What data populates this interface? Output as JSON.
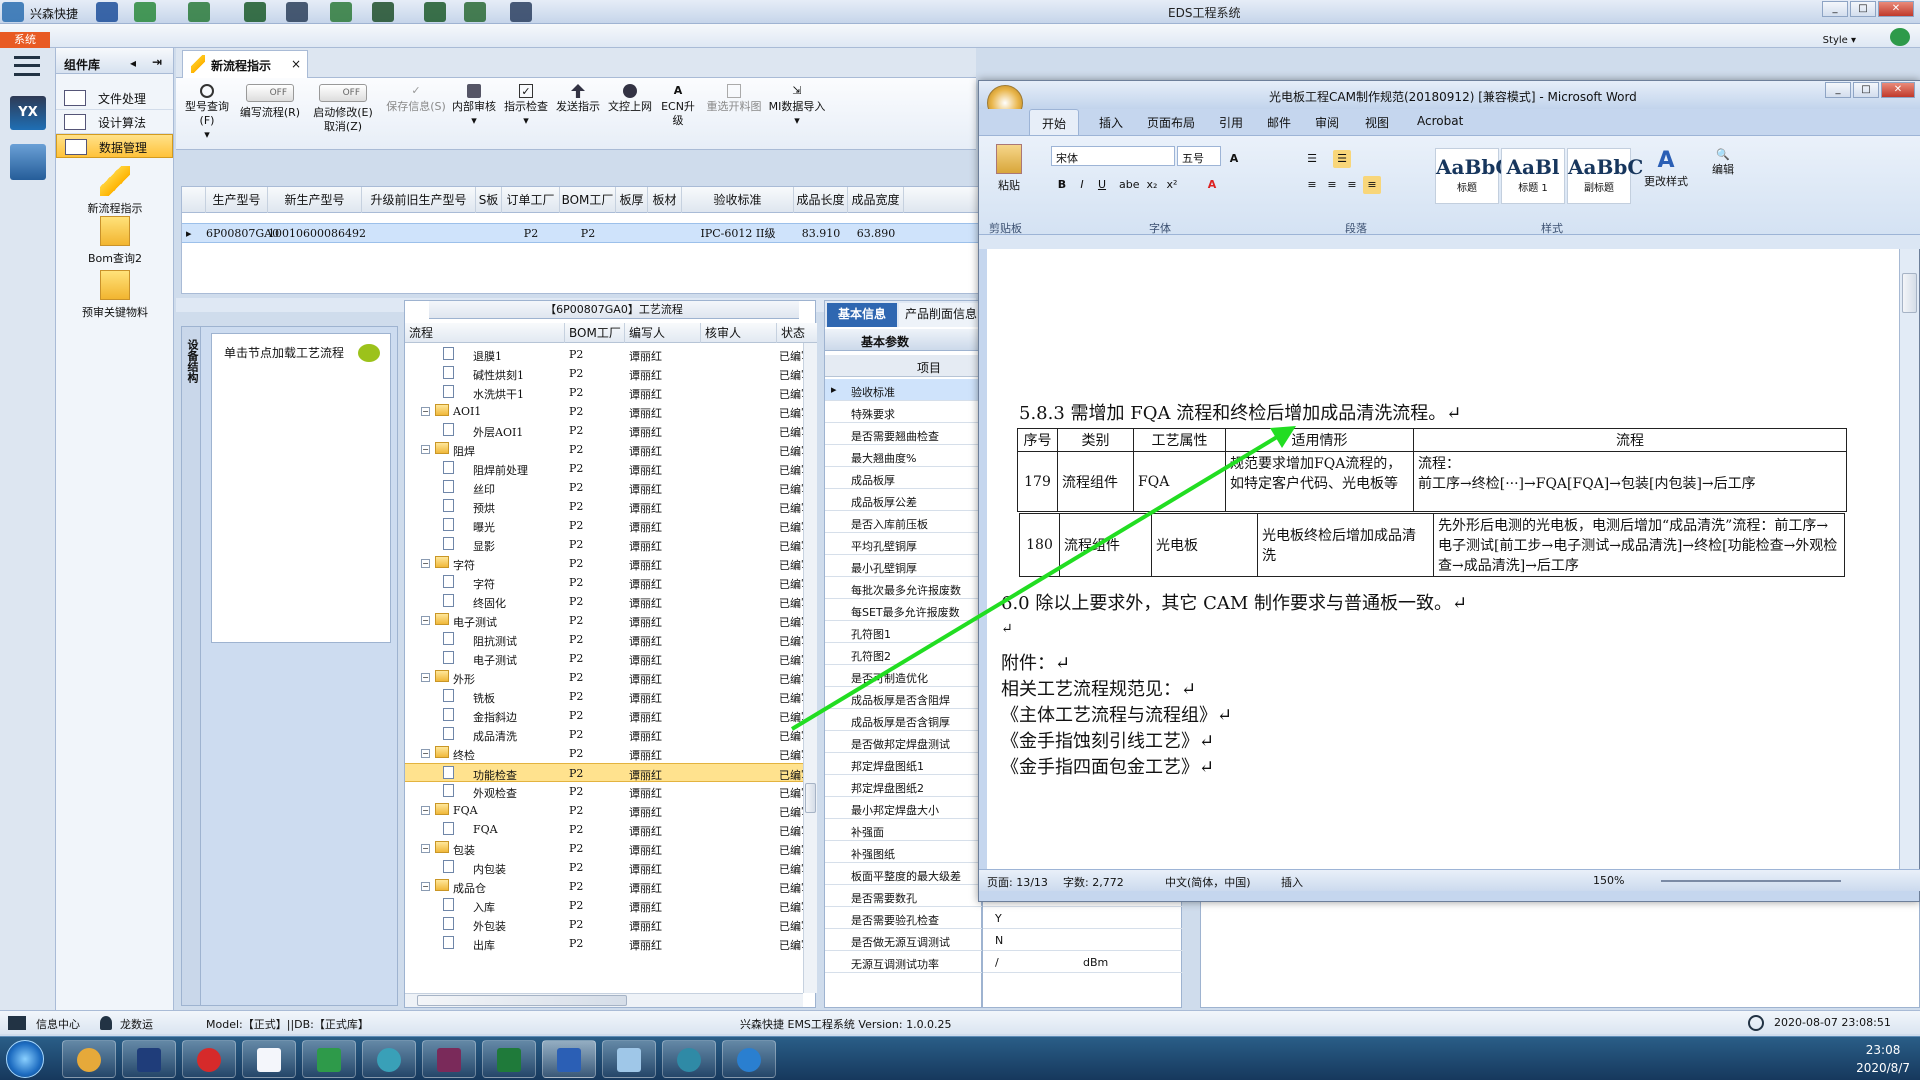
{
  "app": {
    "title": "EDS工程系统",
    "quick_label": "兴森快捷",
    "system_btn": "系统",
    "style_label": "Style"
  },
  "component_lib": {
    "header": "组件库",
    "nav": [
      {
        "label": "文件处理"
      },
      {
        "label": "设计算法"
      },
      {
        "label": "数据管理"
      }
    ],
    "tools": [
      {
        "label": "新流程指示"
      },
      {
        "label": "Bom查询2"
      },
      {
        "label": "预审关键物料"
      }
    ]
  },
  "doc_tab": "新流程指示",
  "ribbon": [
    {
      "label": "型号查询(F)"
    },
    {
      "label": "编写流程(R)",
      "toggle": "OFF"
    },
    {
      "label": "启动修改(E)",
      "label2": "取消(Z)",
      "toggle": "OFF"
    },
    {
      "label": "保存信息(S)"
    },
    {
      "label": "内部审核"
    },
    {
      "label": "指示检查"
    },
    {
      "label": "发送指示"
    },
    {
      "label": "文控上网"
    },
    {
      "label": "ECN升级"
    },
    {
      "label": "重选开料图"
    },
    {
      "label": "MI数据导入"
    }
  ],
  "grid": {
    "columns": [
      "生产型号",
      "新生产型号",
      "升级前旧生产型号",
      "S板",
      "订单工厂",
      "BOM工厂",
      "板厚",
      "板材",
      "验收标准",
      "成品长度",
      "成品宽度"
    ],
    "row": [
      "6P00807GA0",
      "10010600086492",
      "",
      "",
      "P2",
      "P2",
      "",
      "",
      "IPC-6012 II级",
      "83.910",
      "63.890"
    ]
  },
  "left_vertical": "设备结构",
  "left_hint": "单击节点加载工艺流程",
  "tree": {
    "title": "【6P00807GA0】工艺流程",
    "columns": [
      "流程",
      "BOM工厂",
      "编写人",
      "核审人",
      "状态"
    ],
    "rows": [
      {
        "name": "退膜1",
        "level": 2,
        "bom": "P2",
        "writer": "谭丽红",
        "status": "已编写"
      },
      {
        "name": "碱性烘刻1",
        "level": 2,
        "bom": "P2",
        "writer": "谭丽红",
        "status": "已编写"
      },
      {
        "name": "水洗烘干1",
        "level": 2,
        "bom": "P2",
        "writer": "谭丽红",
        "status": "已编写"
      },
      {
        "name": "AOI1",
        "level": 1,
        "bom": "P2",
        "writer": "谭丽红",
        "status": "已编写"
      },
      {
        "name": "外层AOI1",
        "level": 2,
        "bom": "P2",
        "writer": "谭丽红",
        "status": "已编写"
      },
      {
        "name": "阻焊",
        "level": 1,
        "bom": "P2",
        "writer": "谭丽红",
        "status": "已编写"
      },
      {
        "name": "阻焊前处理",
        "level": 2,
        "bom": "P2",
        "writer": "谭丽红",
        "status": "已编写"
      },
      {
        "name": "丝印",
        "level": 2,
        "bom": "P2",
        "writer": "谭丽红",
        "status": "已编写"
      },
      {
        "name": "预烘",
        "level": 2,
        "bom": "P2",
        "writer": "谭丽红",
        "status": "已编写"
      },
      {
        "name": "曝光",
        "level": 2,
        "bom": "P2",
        "writer": "谭丽红",
        "status": "已编写"
      },
      {
        "name": "显影",
        "level": 2,
        "bom": "P2",
        "writer": "谭丽红",
        "status": "已编写"
      },
      {
        "name": "字符",
        "level": 1,
        "bom": "P2",
        "writer": "谭丽红",
        "status": "已编写"
      },
      {
        "name": "字符",
        "level": 2,
        "bom": "P2",
        "writer": "谭丽红",
        "status": "已编写"
      },
      {
        "name": "终固化",
        "level": 2,
        "bom": "P2",
        "writer": "谭丽红",
        "status": "已编写"
      },
      {
        "name": "电子测试",
        "level": 1,
        "bom": "P2",
        "writer": "谭丽红",
        "status": "已编写"
      },
      {
        "name": "阻抗测试",
        "level": 2,
        "bom": "P2",
        "writer": "谭丽红",
        "status": "已编写"
      },
      {
        "name": "电子测试",
        "level": 2,
        "bom": "P2",
        "writer": "谭丽红",
        "status": "已编写"
      },
      {
        "name": "外形",
        "level": 1,
        "bom": "P2",
        "writer": "谭丽红",
        "status": "已编写"
      },
      {
        "name": "铣板",
        "level": 2,
        "bom": "P2",
        "writer": "谭丽红",
        "status": "已编写"
      },
      {
        "name": "金指斜边",
        "level": 2,
        "bom": "P2",
        "writer": "谭丽红",
        "status": "已编写"
      },
      {
        "name": "成品清洗",
        "level": 2,
        "bom": "P2",
        "writer": "谭丽红",
        "status": "已编写"
      },
      {
        "name": "终检",
        "level": 1,
        "bom": "P2",
        "writer": "谭丽红",
        "status": "已编写"
      },
      {
        "name": "功能检查",
        "level": 2,
        "bom": "P2",
        "writer": "谭丽红",
        "status": "已编写",
        "selected": true
      },
      {
        "name": "外观检查",
        "level": 2,
        "bom": "P2",
        "writer": "谭丽红",
        "status": "已编写"
      },
      {
        "name": "FQA",
        "level": 1,
        "bom": "P2",
        "writer": "谭丽红",
        "status": "已编写"
      },
      {
        "name": "FQA",
        "level": 2,
        "bom": "P2",
        "writer": "谭丽红",
        "status": "已编写"
      },
      {
        "name": "包装",
        "level": 1,
        "bom": "P2",
        "writer": "谭丽红",
        "status": "已编写"
      },
      {
        "name": "内包装",
        "level": 2,
        "bom": "P2",
        "writer": "谭丽红",
        "status": "已编写"
      },
      {
        "name": "成品仓",
        "level": 1,
        "bom": "P2",
        "writer": "谭丽红",
        "status": "已编写"
      },
      {
        "name": "入库",
        "level": 2,
        "bom": "P2",
        "writer": "谭丽红",
        "status": "已编写"
      },
      {
        "name": "外包装",
        "level": 2,
        "bom": "P2",
        "writer": "谭丽红",
        "status": "已编写"
      },
      {
        "name": "出库",
        "level": 2,
        "bom": "P2",
        "writer": "谭丽红",
        "status": "已编写"
      }
    ]
  },
  "props": {
    "tab1": "基本信息",
    "tab2": "产品削面信息",
    "section": "基本参数",
    "col": "项目",
    "rows": [
      {
        "label": "验收标准",
        "selected": true
      },
      {
        "label": "特殊要求"
      },
      {
        "label": "是否需要翘曲检查"
      },
      {
        "label": "最大翘曲度%"
      },
      {
        "label": "成品板厚"
      },
      {
        "label": "成品板厚公差"
      },
      {
        "label": "是否入库前压板"
      },
      {
        "label": "平均孔壁铜厚"
      },
      {
        "label": "最小孔壁铜厚"
      },
      {
        "label": "每批次最多允许报废数"
      },
      {
        "label": "每SET最多允许报废数"
      },
      {
        "label": "孔符图1"
      },
      {
        "label": "孔符图2"
      },
      {
        "label": "是否可制造优化"
      },
      {
        "label": "成品板厚是否含阻焊"
      },
      {
        "label": "成品板厚是否含铜厚"
      },
      {
        "label": "是否做邦定焊盘测试"
      },
      {
        "label": "邦定焊盘图纸1"
      },
      {
        "label": "邦定焊盘图纸2"
      },
      {
        "label": "最小邦定焊盘大小"
      },
      {
        "label": "补强面"
      },
      {
        "label": "补强图纸"
      },
      {
        "label": "板面平整度的最大级差"
      },
      {
        "label": "是否需要数孔",
        "value": ""
      },
      {
        "label": "是否需要验孔检查",
        "value": "Y"
      },
      {
        "label": "是否做无源互调测试",
        "value": "N"
      },
      {
        "label": "无源互调测试功率",
        "value": "/",
        "unit": "dBm"
      }
    ]
  },
  "status": {
    "info_center": "信息中心",
    "user": "龙数运",
    "model": "Model:【正式】||DB:【正式库】",
    "version": "兴森快捷 EMS工程系统 Version: 1.0.0.25",
    "datetime": "2020-08-07 23:08:51"
  },
  "taskbar": {
    "time": "23:08",
    "date": "2020/8/7"
  },
  "word": {
    "title": "光电板工程CAM制作规范(20180912) [兼容模式] - Microsoft Word",
    "tabs": [
      "开始",
      "插入",
      "页面布局",
      "引用",
      "邮件",
      "审阅",
      "视图",
      "Acrobat"
    ],
    "font": "宋体",
    "size": "五号",
    "groups": [
      "剪贴板",
      "字体",
      "段落",
      "样式"
    ],
    "paste": "粘贴",
    "change_style": "更改样式",
    "edit": "编辑",
    "styles": [
      {
        "sample": "AaBbC",
        "name": "标题"
      },
      {
        "sample": "AaBl",
        "name": "标题 1"
      },
      {
        "sample": "AaBbC",
        "name": "副标题"
      }
    ],
    "heading": "5.8.3  需增加 FQA 流程和终检后增加成品清洗流程。↵",
    "table1": {
      "headers": [
        "序号",
        "类别",
        "工艺属性",
        "适用情形",
        "流程"
      ],
      "row": [
        "179",
        "流程组件",
        "FQA",
        "规范要求增加FQA流程的，如特定客户代码、光电板等",
        "流程：\n前工序→终检[···]→FQA[FQA]→包装[内包装]→后工序"
      ]
    },
    "table2": {
      "row": [
        "180",
        "流程组件",
        "光电板",
        "光电板终检后增加成品清洗",
        "先外形后电测的光电板，电测后增加“成品清洗”流程：前工序→电子测试[前工步→电子测试→成品清洗]→终检[功能检查→外观检查→成品清洗]→后工序"
      ]
    },
    "p6": "6.0  除以上要求外，其它 CAM 制作要求与普通板一致。↵",
    "lines": [
      "附件：↵",
      "相关工艺流程规范见：↵",
      "《主体工艺流程与流程组》↵",
      "《金手指蚀刻引线工艺》↵",
      "《金手指四面包金工艺》↵"
    ],
    "status": {
      "page": "页面: 13/13",
      "words": "字数: 2,772",
      "lang": "中文(简体，中国)",
      "mode": "插入",
      "zoom": "150%"
    }
  },
  "colors": {
    "arrow": "#22dd22",
    "accent": "#2f67b1",
    "selected": "#ffe28e"
  }
}
